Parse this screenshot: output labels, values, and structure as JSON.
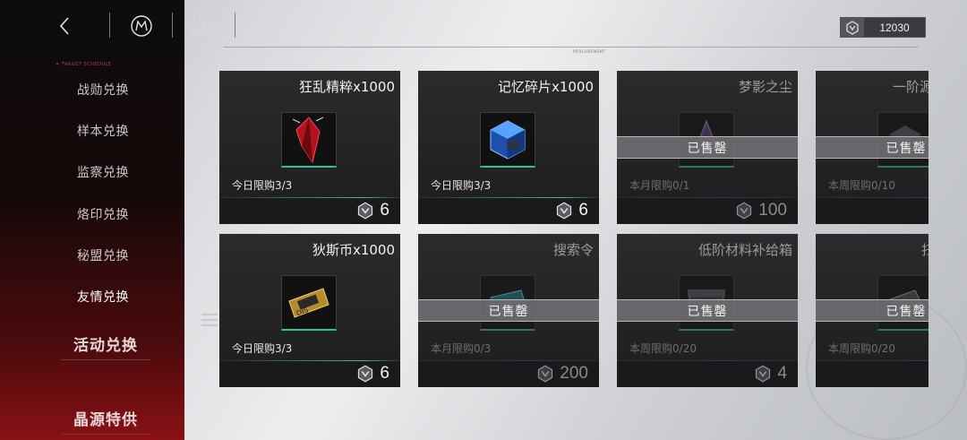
{
  "nav": {
    "back_icon": "chevron-left-icon",
    "logo_icon": "m-emblem-icon",
    "tree_icon": "hierarchy-icon"
  },
  "sidebar": {
    "tag": "TARGET SCHEDULE",
    "items": [
      {
        "label": "战勋兑换",
        "active": false
      },
      {
        "label": "样本兑换",
        "active": false
      },
      {
        "label": "监察兑换",
        "active": false
      },
      {
        "label": "烙印兑换",
        "active": false
      },
      {
        "label": "秘盟兑换",
        "active": false
      },
      {
        "label": "友情兑换",
        "active": true
      }
    ],
    "sections": [
      {
        "label": "活动兑换"
      },
      {
        "label": "晶源特供"
      }
    ]
  },
  "currency": {
    "icon": "token-icon",
    "value": "12030"
  },
  "header_rule_label": "PROCUREMENT",
  "sold_label": "已售罄",
  "colors": {
    "accent_green": "#2ec48f",
    "sidebar_red": "#8a1114"
  },
  "cards": [
    {
      "name": "狂乱精粹x1000",
      "limit": "今日限购3/3",
      "price": "6",
      "sold": false,
      "icon": "red-crystal-icon"
    },
    {
      "name": "记忆碎片x1000",
      "limit": "今日限购3/3",
      "price": "6",
      "sold": false,
      "icon": "blue-cube-icon"
    },
    {
      "name": "梦影之尘",
      "limit": "本月限购0/1",
      "price": "100",
      "sold": true,
      "icon": "dust-vial-icon"
    },
    {
      "name": "一阶源",
      "limit": "本周限购0/10",
      "price": "",
      "sold": true,
      "icon": "material-box-icon"
    },
    {
      "name": "狄斯币x1000",
      "limit": "今日限购3/3",
      "price": "6",
      "sold": false,
      "icon": "gold-ticket-icon"
    },
    {
      "name": "搜索令",
      "limit": "本月限购0/3",
      "price": "200",
      "sold": true,
      "icon": "search-token-icon"
    },
    {
      "name": "低阶材料补给箱",
      "limit": "本周限购0/20",
      "price": "4",
      "sold": true,
      "icon": "supply-crate-icon"
    },
    {
      "name": "扫",
      "limit": "本周限购0/20",
      "price": "",
      "sold": true,
      "icon": "device-icon"
    }
  ]
}
